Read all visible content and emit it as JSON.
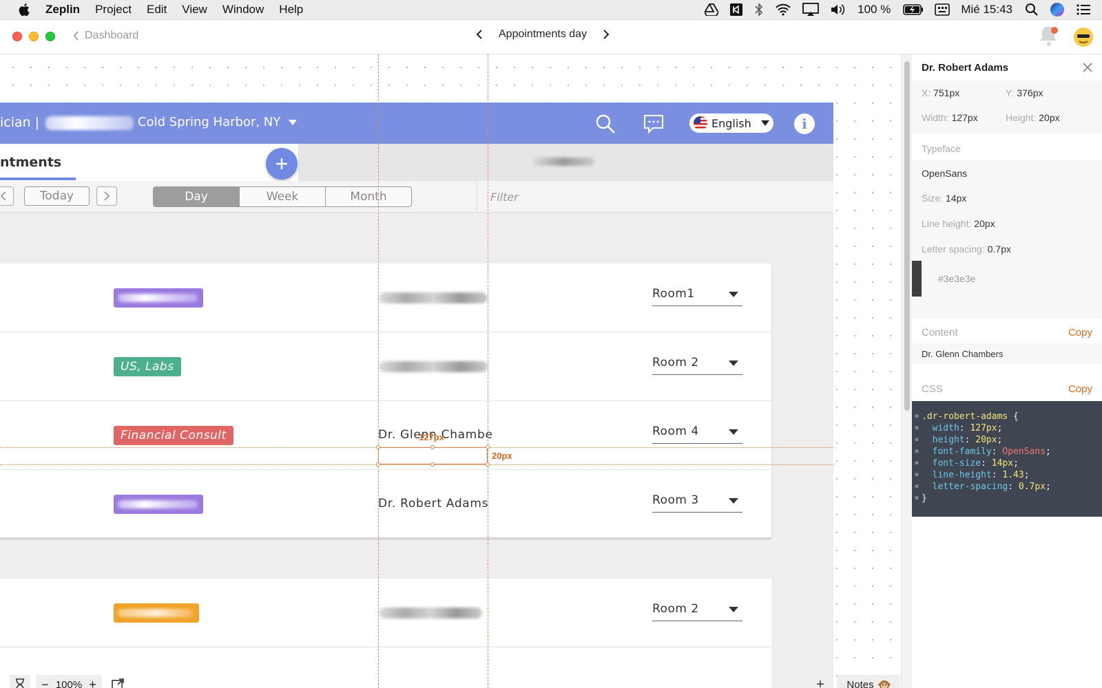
{
  "menubar": {
    "app_name": "Zeplin",
    "items": [
      "Project",
      "Edit",
      "View",
      "Window",
      "Help"
    ],
    "battery": "100 %",
    "clock": "Mié 15:43"
  },
  "titlebar": {
    "back_label": "Dashboard",
    "title": "Appointments day"
  },
  "design": {
    "header": {
      "role_fragment": "ician |",
      "location": "Cold Spring Harbor, NY",
      "language": "English"
    },
    "tab_label": "ntments",
    "toolbar": {
      "today": "Today",
      "views": [
        "Day",
        "Week",
        "Month"
      ],
      "active_view": "Day",
      "filter_placeholder": "Filter"
    },
    "rows": [
      {
        "tag": "",
        "tag_color": "#9b7ae0",
        "doctor": "",
        "room": "Room1"
      },
      {
        "tag": "US, Labs",
        "tag_color": "#4caf8e",
        "doctor": "",
        "room": "Room 2"
      },
      {
        "tag": "Financial Consult",
        "tag_color": "#e06565",
        "doctor": "Dr. Glenn Chambe",
        "room": "Room 4"
      },
      {
        "tag": "",
        "tag_color": "#9b7ae0",
        "doctor": "Dr. Robert Adams",
        "room": "Room 3"
      },
      {
        "tag": "",
        "tag_color": "#f0a22a",
        "doctor": "",
        "room": "Room 2"
      }
    ]
  },
  "measure": {
    "width_label": "127px",
    "height_label": "20px"
  },
  "canvas_footer": {
    "zoom": "100%",
    "notes_label": "Notes"
  },
  "inspector": {
    "layer_name": "Dr. Robert Adams",
    "x_label": "X:",
    "x_value": "751px",
    "y_label": "Y:",
    "y_value": "376px",
    "w_label": "Width:",
    "w_value": "127px",
    "h_label": "Height:",
    "h_value": "20px",
    "typeface_heading": "Typeface",
    "font_name": "OpenSans",
    "size_label": "Size:",
    "size_value": "14px",
    "lh_label": "Line height:",
    "lh_value": "20px",
    "ls_label": "Letter spacing:",
    "ls_value": "0.7px",
    "color_hex": "#3e3e3e",
    "content_heading": "Content",
    "content_copy": "Copy",
    "content_text": "Dr. Glenn Chambers",
    "css_heading": "CSS",
    "css_copy": "Copy",
    "css": {
      "selector": ".dr-robert-adams",
      "props": [
        {
          "k": "width",
          "v": "127px"
        },
        {
          "k": "height",
          "v": "20px"
        },
        {
          "k": "font-family",
          "v": "OpenSans"
        },
        {
          "k": "font-size",
          "v": "14px"
        },
        {
          "k": "line-height",
          "v": "1.43"
        },
        {
          "k": "letter-spacing",
          "v": "0.7px"
        }
      ]
    }
  },
  "colors": {
    "primary": "#7a8fe0",
    "accent_orange": "#d96a1f",
    "text_color_swatch": "#3e3e3e"
  }
}
